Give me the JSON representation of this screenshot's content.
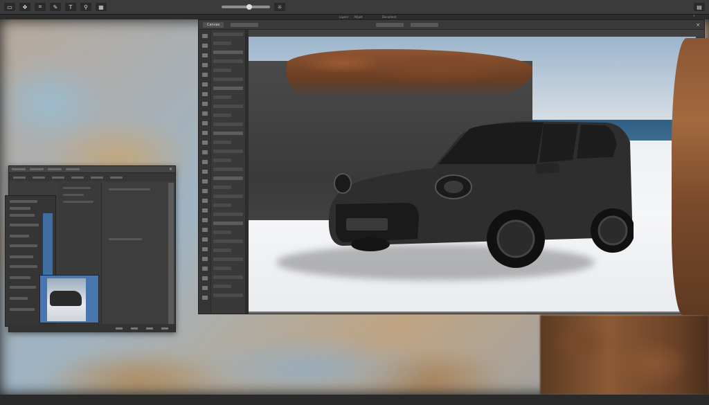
{
  "app": {
    "title": "Photo Editor",
    "top_tab": "Document",
    "subbar_items": [
      "Layers",
      "Adjust"
    ]
  },
  "toolbar": {
    "buttons": [
      {
        "icon": "select-icon",
        "glyph": "▭"
      },
      {
        "icon": "move-icon",
        "glyph": "✥"
      },
      {
        "icon": "crop-icon",
        "glyph": "⌗"
      },
      {
        "icon": "brush-icon",
        "glyph": "✎"
      },
      {
        "icon": "text-icon",
        "glyph": "T"
      },
      {
        "icon": "zoom-icon",
        "glyph": "⚲"
      },
      {
        "icon": "grid-icon",
        "glyph": "▦"
      }
    ]
  },
  "main_window": {
    "tab": "Canvas",
    "close_glyph": "×"
  },
  "small_window": {
    "close_glyph": "×"
  },
  "colors": {
    "app_bg": "#1e1e1e",
    "panel": "#3c3c3c",
    "accent_blue": "#3f6fa2",
    "car_body": "#2c2c2c"
  }
}
